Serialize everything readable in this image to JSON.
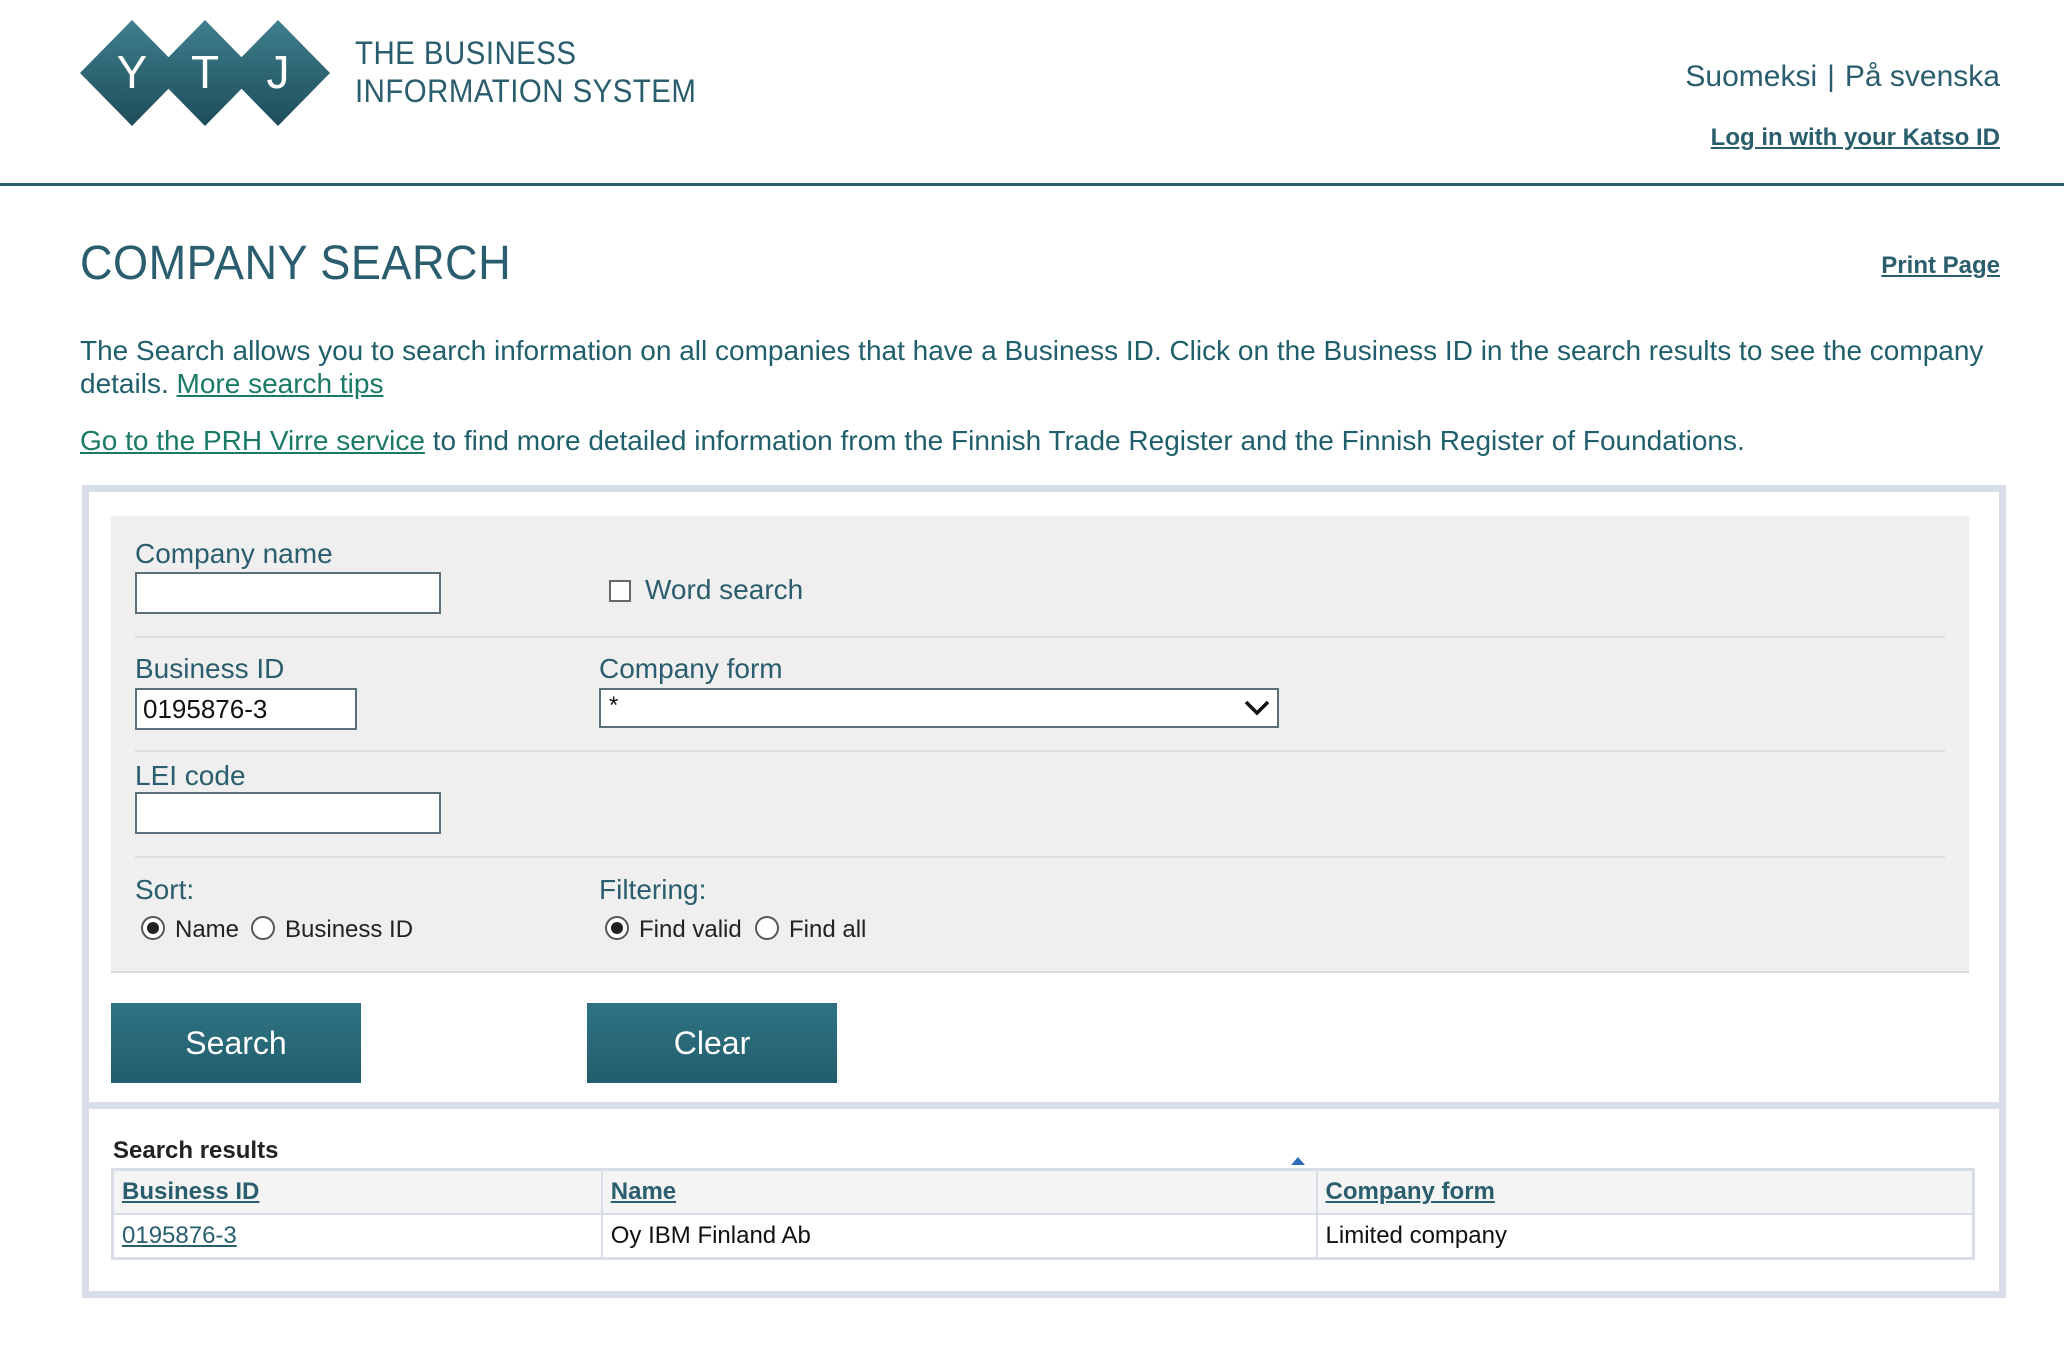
{
  "header": {
    "logo_letters": [
      "Y",
      "T",
      "J"
    ],
    "logo_line1": "THE BUSINESS",
    "logo_line2": "INFORMATION SYSTEM",
    "lang_fi": "Suomeksi",
    "lang_sep": "|",
    "lang_sv": "På svenska",
    "login_link": "Log in with your Katso ID"
  },
  "page": {
    "title": "COMPANY SEARCH",
    "print_link": "Print Page",
    "intro_text": "The Search allows you to search information on all companies that have a Business ID. Click on the Business ID in the search results to see the company details.",
    "tips_link": "More search tips",
    "virre_link": "Go to the PRH Virre service",
    "virre_text": " to find more detailed information from the Finnish Trade Register and the Finnish Register of Foundations."
  },
  "form": {
    "company_name_label": "Company name",
    "company_name_value": "",
    "word_search_label": "Word search",
    "word_search_checked": false,
    "business_id_label": "Business ID",
    "business_id_value": "0195876-3",
    "company_form_label": "Company form",
    "company_form_value": "*",
    "lei_label": "LEI code",
    "lei_value": "",
    "sort_label": "Sort:",
    "sort_name": "Name",
    "sort_business_id": "Business ID",
    "sort_selected": "Name",
    "filter_label": "Filtering:",
    "filter_valid": "Find valid",
    "filter_all": "Find all",
    "filter_selected": "Find valid",
    "search_button": "Search",
    "clear_button": "Clear"
  },
  "results": {
    "title": "Search results",
    "columns": [
      "Business ID",
      "Name",
      "Company form"
    ],
    "rows": [
      {
        "business_id": "0195876-3",
        "name": "Oy IBM Finland Ab",
        "company_form": "Limited company"
      }
    ]
  },
  "colors": {
    "brand": "#2a5d6d",
    "button": "#2a6b7a",
    "link_green": "#1a7a66",
    "panel_border": "#d7dee8"
  }
}
